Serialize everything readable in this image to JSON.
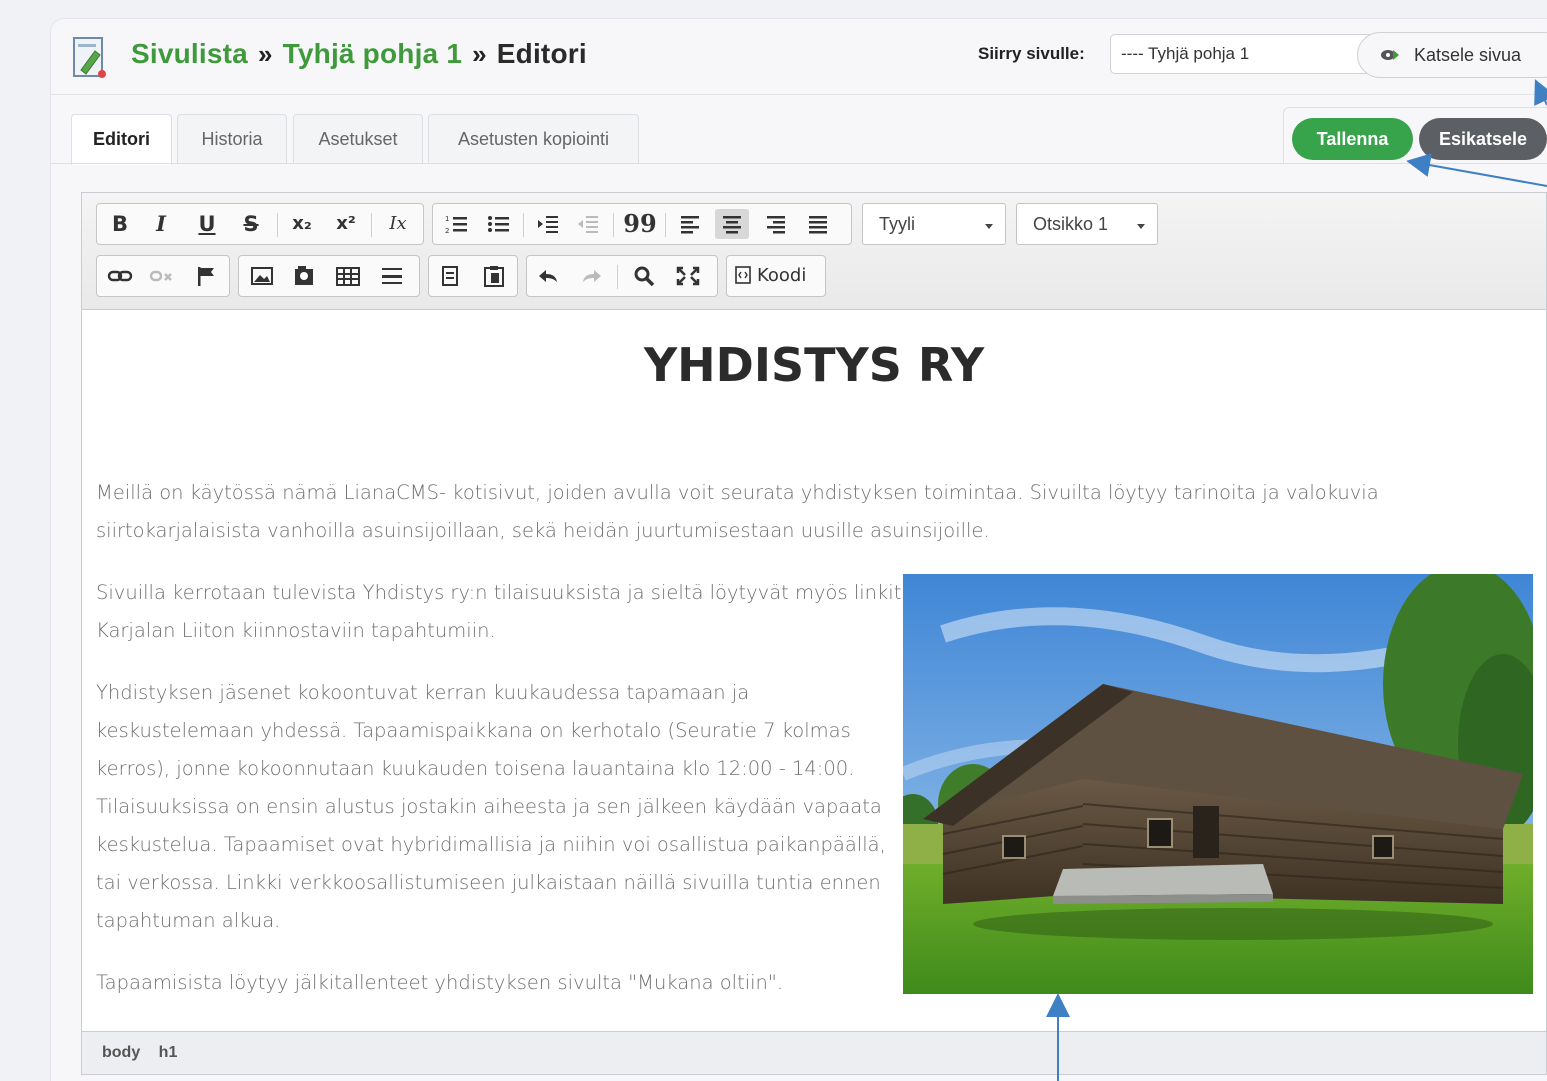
{
  "header": {
    "breadcrumb": [
      "Sivulista",
      "Tyhjä pohja 1",
      "Editori"
    ],
    "separator": "»",
    "goto_label": "Siirry sivulle:",
    "goto_selected": "---- Tyhjä pohja 1",
    "view_page_label": "Katsele sivua"
  },
  "tabs": [
    {
      "label": "Editori",
      "active": true
    },
    {
      "label": "Historia",
      "active": false
    },
    {
      "label": "Asetukset",
      "active": false
    },
    {
      "label": "Asetusten kopiointi",
      "active": false
    }
  ],
  "actions": {
    "save_label": "Tallenna",
    "preview_label": "Esikatsele"
  },
  "toolbar": {
    "style_combo": "Tyyli",
    "format_combo": "Otsikko 1",
    "code_label": "Koodi",
    "buttons": {
      "bold": "B",
      "italic": "I",
      "underline": "U",
      "strike": "S",
      "subscript": "x₂",
      "superscript": "x²",
      "remove_format": "Ix",
      "blockquote": "99"
    }
  },
  "document": {
    "heading": "YHDISTYS RY",
    "paragraphs": [
      "Meillä on käytössä nämä LianaCMS- kotisivut, joiden avulla voit seurata yhdistyksen toimintaa. Sivuilta löytyy tarinoita ja valokuvia siirtokarjalaisista vanhoilla asuinsijoillaan, sekä heidän juurtumisestaan uusille asuinsijoille.",
      "Sivuilla kerrotaan tulevista Yhdistys ry:n tilaisuuksista ja sieltä löytyvät myös linkit Karjalan Liiton kiinnostaviin tapahtumiin.",
      "Yhdistyksen jäsenet kokoontuvat kerran kuukaudessa tapamaan ja keskustelemaan yhdessä. Tapaamispaikkana on kerhotalo (Seuratie 7 kolmas kerros), jonne kokoonnutaan kuukauden toisena lauantaina klo 12:00 - 14:00. Tilaisuuksissa on ensin alustus jostakin aiheesta ja sen jälkeen käydään vapaata keskustelua. Tapaamiset ovat hybridimallisia ja niihin voi osallistua paikanpäällä, tai verkossa. Linkki verkkoosallistumiseen julkaistaan näillä sivuilla tuntia ennen tapahtuman alkua.",
      "Tapaamisista löytyy jälkitallenteet yhdistyksen sivulta \"Mukana oltiin\"."
    ]
  },
  "statusbar": {
    "path": [
      "body",
      "h1"
    ]
  },
  "colors": {
    "brand_green": "#3e9a3a",
    "save_green": "#37a34a",
    "preview_gray": "#5c5f63",
    "arrow_blue": "#3f7fc4"
  }
}
